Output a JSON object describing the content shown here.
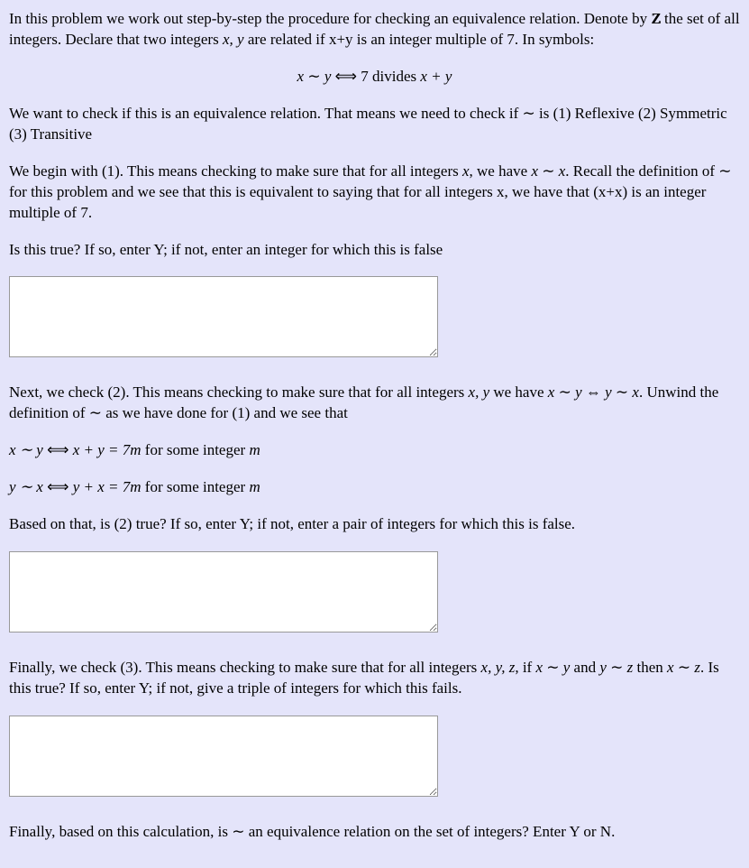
{
  "p1a": "In this problem we work out step-by-step the procedure for checking an equivalence relation. Denote by ",
  "p1b": " the set of all integers. Declare that two integers ",
  "p1c": " are related if x+y is an integer multiple of 7. In symbols:",
  "disp1_lhs_x": "x",
  "disp1_rel": " ∼ ",
  "disp1_lhs_y": "y",
  "disp1_iff": "  ⟺  ",
  "disp1_txt": "7 divides ",
  "disp1_rhs": "x + y",
  "p2": "We want to check if this is an equivalence relation. That means we need to check if ∼ is (1) Reflexive (2) Symmetric (3) Transitive",
  "p3a": "We begin with (1). This means checking to make sure that for all integers ",
  "p3b": ", we have ",
  "p3c": ". Recall the definition of ∼ for this problem and we see that this is equivalent to saying that for all integers x, we have that (x+x) is an integer multiple of 7.",
  "p4": "Is this true? If so, enter Y; if not, enter an integer for which this is false",
  "p5a": "Next, we check (2). This means checking to make sure that for all integers ",
  "p5b": " we have ",
  "p5c": ". Unwind the definition of ∼ as we have done for (1) and we see that",
  "line1a": "x ∼ y",
  "line1b": " ⟺ ",
  "line1c": "x + y = 7m",
  "line1d": " for some integer ",
  "line1e": "m",
  "line2a": "y ∼ x",
  "line2b": " ⟺ ",
  "line2c": "y + x = 7m",
  "line2d": " for some integer ",
  "line2e": "m",
  "p6": "Based on that, is (2) true? If so, enter Y; if not, enter a pair of integers for which this is false.",
  "p7a": "Finally, we check (3). This means checking to make sure that for all integers ",
  "p7b": ", if ",
  "p7c": " and ",
  "p7d": " then ",
  "p7e": ". Is this true? If so, enter Y; if not, give a triple of integers for which this fails.",
  "p8": "Finally, based on this calculation, is ∼ an equivalence relation on the set of integers? Enter Y or N.",
  "var_x": "x",
  "var_y": "y",
  "var_z": "z",
  "rel_sym": " ∼ ",
  "iff_short": " ⇔ ",
  "comma": ", ",
  "Z": "Z"
}
